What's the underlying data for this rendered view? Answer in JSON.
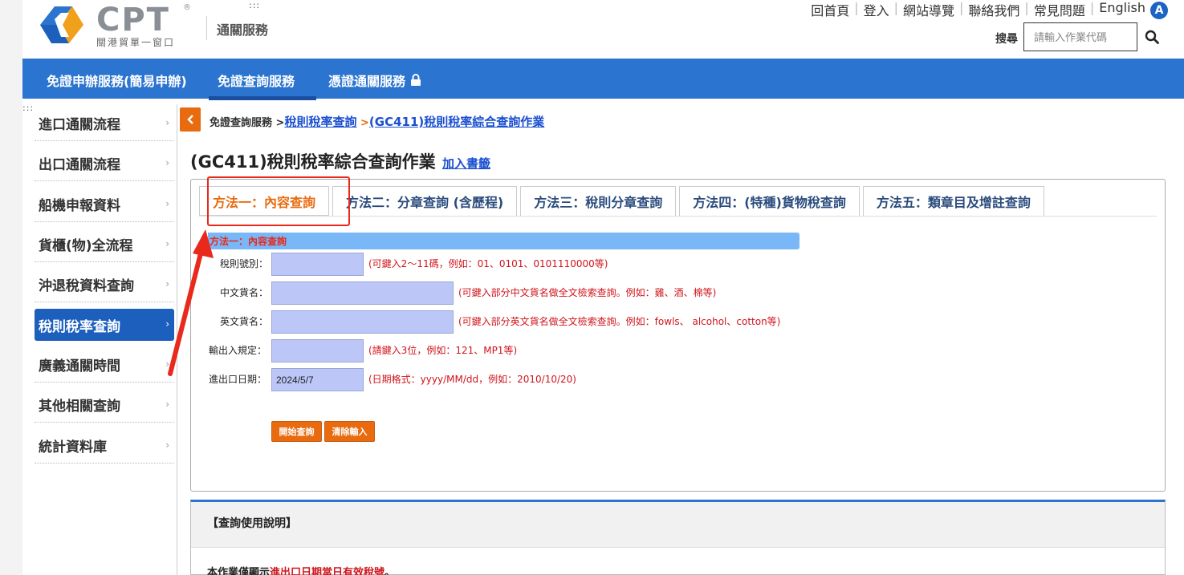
{
  "header": {
    "logo_text": "CPT",
    "logo_reg": "®",
    "logo_sub": "關港貿單一窗口",
    "service_title": "通關服務",
    "dots": ":::",
    "top_links": [
      "回首頁",
      "登入",
      "網站導覽",
      "聯絡我們",
      "常見問題",
      "English"
    ],
    "badge": "A",
    "search_label": "搜尋",
    "search_placeholder": "請輸入作業代碼"
  },
  "navbar": {
    "items": [
      "免證申辦服務(簡易申辦)",
      "免證查詢服務",
      "憑證通關服務"
    ]
  },
  "sidebar": {
    "dots": ":::",
    "items": [
      {
        "label": "進口通關流程",
        "active": false
      },
      {
        "label": "出口通關流程",
        "active": false
      },
      {
        "label": "船機申報資料",
        "active": false
      },
      {
        "label": "貨櫃(物)全流程",
        "active": false
      },
      {
        "label": "沖退稅資料查詢",
        "active": false
      },
      {
        "label": "稅則稅率查詢",
        "active": true
      },
      {
        "label": "廣義通關時間",
        "active": false
      },
      {
        "label": "其他相關查詢",
        "active": false
      },
      {
        "label": "統計資料庫",
        "active": false
      }
    ],
    "chevron": "›"
  },
  "breadcrumb": {
    "root": "免證查詢服務",
    "sep": ">",
    "level1": "稅則稅率查詢",
    "level2": "(GC411)稅則稅率綜合查詢作業"
  },
  "page": {
    "title": "(GC411)稅則稅率綜合查詢作業",
    "bookmark": "加入書籤"
  },
  "tabs": [
    {
      "label": "方法一：內容查詢",
      "active": true
    },
    {
      "label": "方法二：分章查詢 (含歷程)",
      "active": false
    },
    {
      "label": "方法三：稅則分章查詢",
      "active": false
    },
    {
      "label": "方法四：(特種)貨物稅查詢",
      "active": false
    },
    {
      "label": "方法五：類章目及增註查詢",
      "active": false
    }
  ],
  "form": {
    "header": "方法一：內容查詢",
    "fields": [
      {
        "label": "稅則號別：",
        "value": "",
        "hint": "(可鍵入2～11碼，例如：01、0101、0101110000等)"
      },
      {
        "label": "中文貨名：",
        "value": "",
        "hint": "(可鍵入部分中文貨名做全文檢索查詢。例如：雞、酒、棉等)"
      },
      {
        "label": "英文貨名：",
        "value": "",
        "hint": "(可鍵入部分英文貨名做全文檢索查詢。例如：fowls、 alcohol、cotton等)"
      },
      {
        "label": "輸出入規定：",
        "value": "",
        "hint": "(請鍵入3位，例如：121、MP1等)"
      },
      {
        "label": "進出口日期：",
        "value": "2024/5/7",
        "hint": "(日期格式：yyyy/MM/dd，例如：2010/10/20)"
      }
    ],
    "submit_label": "開始查詢",
    "clear_label": "清除輸入"
  },
  "info": {
    "title": "【查詢使用說明】",
    "text_prefix": "本作業僅顯示",
    "text_highlight": "進出口日期當日有效稅號",
    "text_suffix": "。"
  },
  "colors": {
    "nav_blue": "#2b74cf",
    "active_blue": "#1c5fbd",
    "accent_orange": "#e86b10",
    "hint_red": "#d0141b",
    "field_bg": "#bcc7f8",
    "form_header_bg": "#7ab7f7"
  }
}
